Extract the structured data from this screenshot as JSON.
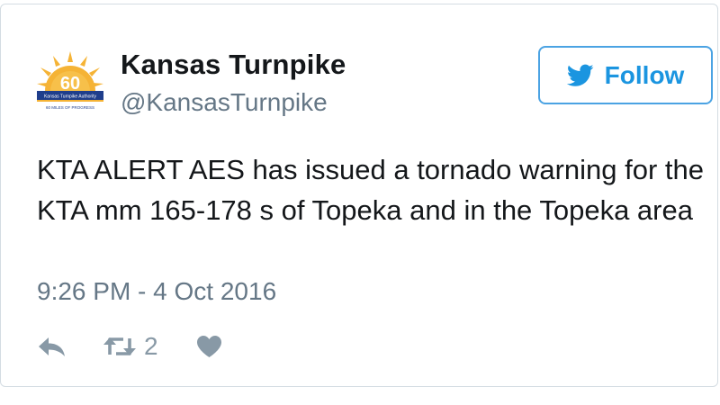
{
  "author": {
    "display_name": "Kansas Turnpike",
    "handle": "@KansasTurnpike",
    "avatar": {
      "badge_number": "60",
      "banner_text": "Kansas Turnpike Authority",
      "tagline": "60 MILES OF PROGRESS"
    }
  },
  "follow_button": {
    "label": "Follow",
    "icon": "twitter-bird-icon"
  },
  "tweet": {
    "text": "KTA ALERT AES has issued a tornado warning for the KTA mm 165-178 s of Topeka and in the Topeka area",
    "timestamp": "9:26 PM - 4 Oct 2016"
  },
  "actions": {
    "reply_icon": "reply-icon",
    "retweet_icon": "retweet-icon",
    "retweet_count": "2",
    "like_icon": "heart-icon"
  },
  "colors": {
    "text_primary": "#14171a",
    "text_secondary": "#657786",
    "icon_gray": "#8899a6",
    "twitter_blue": "#1b95e0",
    "follow_border": "#4ba3e3",
    "card_border": "#d4dce2",
    "avatar_sun": "#f5b335",
    "avatar_banner": "#1f3e8c"
  }
}
